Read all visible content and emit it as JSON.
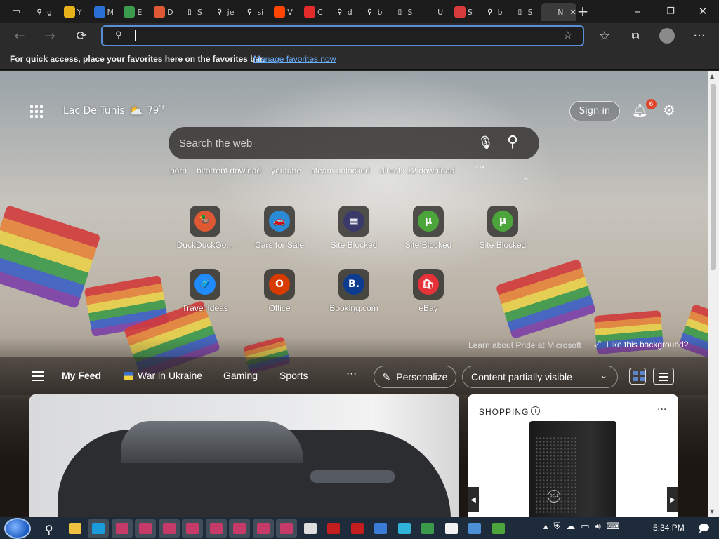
{
  "browser": {
    "tabs": [
      {
        "icon": "search-icon",
        "label": "g",
        "color": "#1c1c1c"
      },
      {
        "icon": "google-icon",
        "label": "Y",
        "color": "#e8b31a"
      },
      {
        "icon": "calendar-icon",
        "label": "M",
        "color": "#2a6fd6"
      },
      {
        "icon": "google-drive-icon",
        "label": "E",
        "color": "#3b9b4f"
      },
      {
        "icon": "duckduckgo-icon",
        "label": "D",
        "color": "#de5833"
      },
      {
        "icon": "page-icon",
        "label": "S",
        "color": "#1c1c1c"
      },
      {
        "icon": "search-icon",
        "label": "je",
        "color": "#1c1c1c"
      },
      {
        "icon": "search-icon",
        "label": "si",
        "color": "#1c1c1c"
      },
      {
        "icon": "reddit-icon",
        "label": "V",
        "color": "#ff4500"
      },
      {
        "icon": "music-icon",
        "label": "C",
        "color": "#e22c2c"
      },
      {
        "icon": "search-icon",
        "label": "d",
        "color": "#1c1c1c"
      },
      {
        "icon": "search-icon",
        "label": "b",
        "color": "#1c1c1c"
      },
      {
        "icon": "page-icon",
        "label": "S",
        "color": "#1c1c1c"
      },
      {
        "icon": "blank-icon",
        "label": "U",
        "color": "#1c1c1c"
      },
      {
        "icon": "shield-icon",
        "label": "S",
        "color": "#d83b3b"
      },
      {
        "icon": "search-icon",
        "label": "b",
        "color": "#1c1c1c"
      },
      {
        "icon": "page-icon",
        "label": "S",
        "color": "#1c1c1c"
      },
      {
        "icon": "blank-icon",
        "label": "N",
        "color": "#3b3b3b",
        "active": true
      }
    ],
    "new_tab": "+",
    "window_buttons": {
      "minimize": "–",
      "restore": "❐",
      "close": "✕"
    },
    "address": {
      "value": "",
      "placeholder": ""
    },
    "favorites_bar": {
      "text": "For quick access, place your favorites here on the favorites bar.",
      "link": "Manage favorites now"
    }
  },
  "newtab": {
    "weather": {
      "location": "Lac De Tunis",
      "temp": "79",
      "unit": "°F"
    },
    "signin": "Sign in",
    "notifications": {
      "count": "6"
    },
    "search": {
      "placeholder": "Search the web"
    },
    "trending": [
      "porn",
      "bitorrent dowload",
      "youtube",
      "steam unlocked",
      "directx 12 download"
    ],
    "trending_more": "···",
    "tiles_row1": [
      {
        "label": "DuckDuckGo...",
        "icon": "duckduckgo-icon",
        "color": "#de5833",
        "glyph": "🦆"
      },
      {
        "label": "Cars for Sale",
        "icon": "car-icon",
        "color": "#2a8ad6",
        "glyph": "🚗"
      },
      {
        "label": "Site Blocked",
        "icon": "blocked-icon",
        "color": "#3a3a6a",
        "glyph": "▦"
      },
      {
        "label": "Site Blocked",
        "icon": "utorrent-icon",
        "color": "#4ba53a",
        "glyph": "µ"
      },
      {
        "label": "Site Blocked",
        "icon": "utorrent-icon",
        "color": "#4ba53a",
        "glyph": "µ"
      }
    ],
    "tiles_row2": [
      {
        "label": "Travel Ideas",
        "icon": "luggage-icon",
        "color": "#1f8bff",
        "glyph": "🧳"
      },
      {
        "label": "Office",
        "icon": "office-icon",
        "color": "#d83b01",
        "glyph": "O"
      },
      {
        "label": "Booking.com",
        "icon": "booking-icon",
        "color": "#0c3b8f",
        "glyph": "B."
      },
      {
        "label": "eBay",
        "icon": "shopping-bag-icon",
        "color": "#e53238",
        "glyph": "🛍"
      }
    ],
    "learn": "Learn about Pride at Microsoft",
    "like_bg": "Like this background?",
    "feed": {
      "tabs": [
        "My Feed",
        "War in Ukraine",
        "Gaming",
        "Sports"
      ],
      "more": "···",
      "personalize": "Personalize",
      "visibility": "Content partially visible"
    },
    "shopping": {
      "header": "SHOPPING",
      "brand": "DELL"
    }
  },
  "taskbar": {
    "apps": [
      {
        "icon": "search-icon",
        "color": "#ffffff"
      },
      {
        "icon": "file-explorer-icon",
        "color": "#f0c040"
      },
      {
        "icon": "app-icon",
        "color": "#1a9bdc"
      },
      {
        "icon": "app-icon",
        "color": "#c63a6a"
      },
      {
        "icon": "app-icon",
        "color": "#c63a6a"
      },
      {
        "icon": "app-icon",
        "color": "#c63a6a"
      },
      {
        "icon": "app-icon",
        "color": "#c63a6a"
      },
      {
        "icon": "app-icon",
        "color": "#c63a6a"
      },
      {
        "icon": "app-icon",
        "color": "#c63a6a"
      },
      {
        "icon": "app-icon",
        "color": "#c63a6a"
      },
      {
        "icon": "app-icon",
        "color": "#c63a6a"
      },
      {
        "icon": "seven-zip-icon",
        "color": "#dddddd"
      },
      {
        "icon": "app-icon",
        "color": "#c41e1e"
      },
      {
        "icon": "app-icon",
        "color": "#c41e1e"
      },
      {
        "icon": "image-icon",
        "color": "#3a7bd5"
      },
      {
        "icon": "edge-icon",
        "color": "#2fb3d8"
      },
      {
        "icon": "flag-icon",
        "color": "#3a9a4a"
      },
      {
        "icon": "bag-icon",
        "color": "#f2f2f2"
      },
      {
        "icon": "network-icon",
        "color": "#4d8fd6"
      },
      {
        "icon": "utorrent-icon",
        "color": "#4ba53a"
      }
    ],
    "clock": "5:34 PM"
  }
}
